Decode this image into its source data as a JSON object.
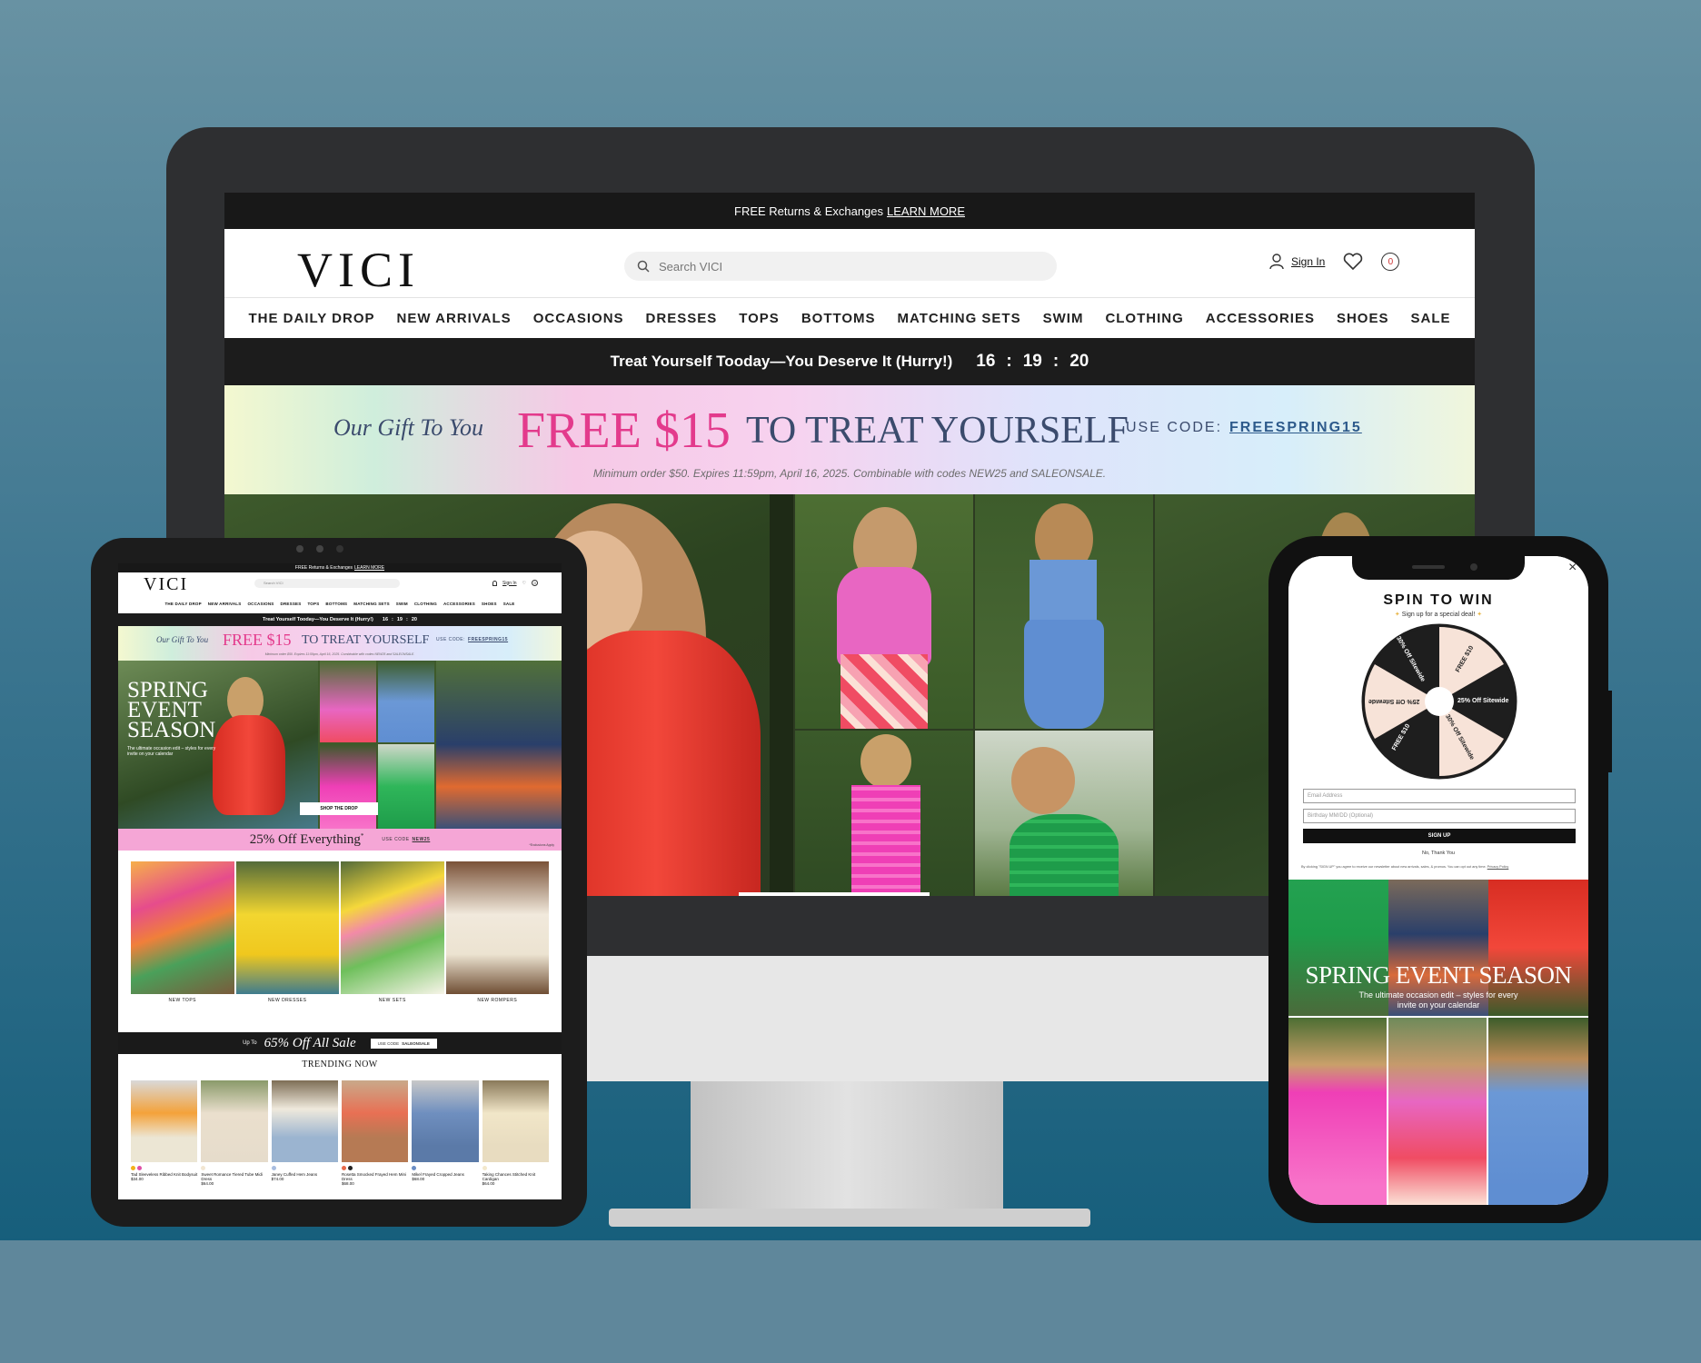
{
  "desktop": {
    "announcement": {
      "text": "FREE Returns & Exchanges",
      "link": "LEARN MORE"
    },
    "logo": "VICI",
    "search_placeholder": "Search VICI",
    "sign_in": "Sign In",
    "cart_count": "0",
    "nav": [
      "THE DAILY DROP",
      "NEW ARRIVALS",
      "OCCASIONS",
      "DRESSES",
      "TOPS",
      "BOTTOMS",
      "MATCHING SETS",
      "SWIM",
      "CLOTHING",
      "ACCESSORIES",
      "SHOES",
      "SALE"
    ],
    "promo_bar": {
      "text": "Treat Yourself Tooday—You Deserve It (Hurry!)",
      "hours": "16",
      "minutes": "19",
      "seconds": "20",
      "sep": ":"
    },
    "gift_banner": {
      "intro": "Our Gift To You",
      "amount": "FREE $15",
      "headline": "TO TREAT YOURSELF",
      "code_label": "USE CODE:",
      "code": "FREESPRING15",
      "fine_print": "Minimum order $50. Expires 11:59pm, April 16, 2025. Combinable with codes NEW25 and SALEONSALE."
    }
  },
  "tablet": {
    "announcement": {
      "text": "FREE Returns & Exchanges",
      "link": "LEARN MORE"
    },
    "logo": "VICI",
    "search_placeholder": "Search VICI",
    "sign_in": "Sign In",
    "cart_count": "0",
    "nav": [
      "THE DAILY DROP",
      "NEW ARRIVALS",
      "OCCASIONS",
      "DRESSES",
      "TOPS",
      "BOTTOMS",
      "MATCHING SETS",
      "SWIM",
      "CLOTHING",
      "ACCESSORIES",
      "SHOES",
      "SALE"
    ],
    "promo_bar": {
      "text": "Treat Yourself Tooday—You Deserve It (Hurry!)",
      "hours": "16",
      "minutes": "19",
      "seconds": "20",
      "sep": ":"
    },
    "gift_banner": {
      "intro": "Our Gift To You",
      "amount": "FREE $15",
      "headline": "TO TREAT YOURSELF",
      "code_label": "USE CODE:",
      "code": "FREESPRING15",
      "fine_print": "Minimum order $50. Expires 11:59pm, April 16, 2025. Combinable with codes NEW25 and SALEONSALE."
    },
    "hero": {
      "title_line1": "SPRING",
      "title_line2": "EVENT",
      "title_line3": "SEASON",
      "subtitle": "The ultimate occasion edit – styles for every invite on your calendar",
      "button": "SHOP THE DROP"
    },
    "sale_banner": {
      "text": "25% Off Everything",
      "asterisk": "*",
      "code_label": "USE CODE",
      "code": "NEW25",
      "note": "*Exclusions Apply"
    },
    "categories": [
      "NEW TOPS",
      "NEW DRESSES",
      "NEW SETS",
      "NEW ROMPERS"
    ],
    "sale_bar": {
      "prefix": "Up To",
      "text": "65% Off All Sale",
      "code_label": "USE CODE",
      "code": "SALEONSALE"
    },
    "trending_title": "TRENDING NOW",
    "products": [
      {
        "name": "Tad Sleeveless Ribbed Knit Bodysuit",
        "price": "$34.00"
      },
      {
        "name": "Sweet Romance Tiered Tube Midi Dress",
        "price": "$64.00"
      },
      {
        "name": "Janey Cuffed Hem Jeans",
        "price": "$74.00"
      },
      {
        "name": "Rosetta Smocked Frayed Hem Mini Dress",
        "price": "$68.00"
      },
      {
        "name": "Mikel Frayed Cropped Jeans",
        "price": "$68.00"
      },
      {
        "name": "Taking Chances Stitched Knit Cardigan",
        "price": "$64.00"
      }
    ]
  },
  "phone": {
    "modal": {
      "title": "SPIN TO WIN",
      "subtitle": "Sign up for a special deal!",
      "wheel_slices": [
        "FREE $10",
        "25% Off Sitewide",
        "30% Off Sitewide",
        "FREE $10",
        "25% Off Sitewide",
        "30% Off Sitewide"
      ],
      "email_placeholder": "Email Address",
      "birthday_placeholder": "Birthday MM/DD (Optional)",
      "submit": "SIGN UP",
      "decline": "No, Thank You",
      "legal": "By clicking \"SIGN UP\" you agree to receive our newsletter about new arrivals, sales, & promos. You can opt out any time.",
      "legal_link": "Privacy Policy",
      "close": "×"
    },
    "hero": {
      "title": "SPRING EVENT SEASON",
      "subtitle": "The ultimate occasion edit – styles for every invite on your calendar"
    }
  },
  "colors": {
    "accent_pink": "#e33a8c",
    "navy": "#3b4b6d",
    "black_bar": "#181818",
    "sale_pink": "#f5a6d6"
  }
}
